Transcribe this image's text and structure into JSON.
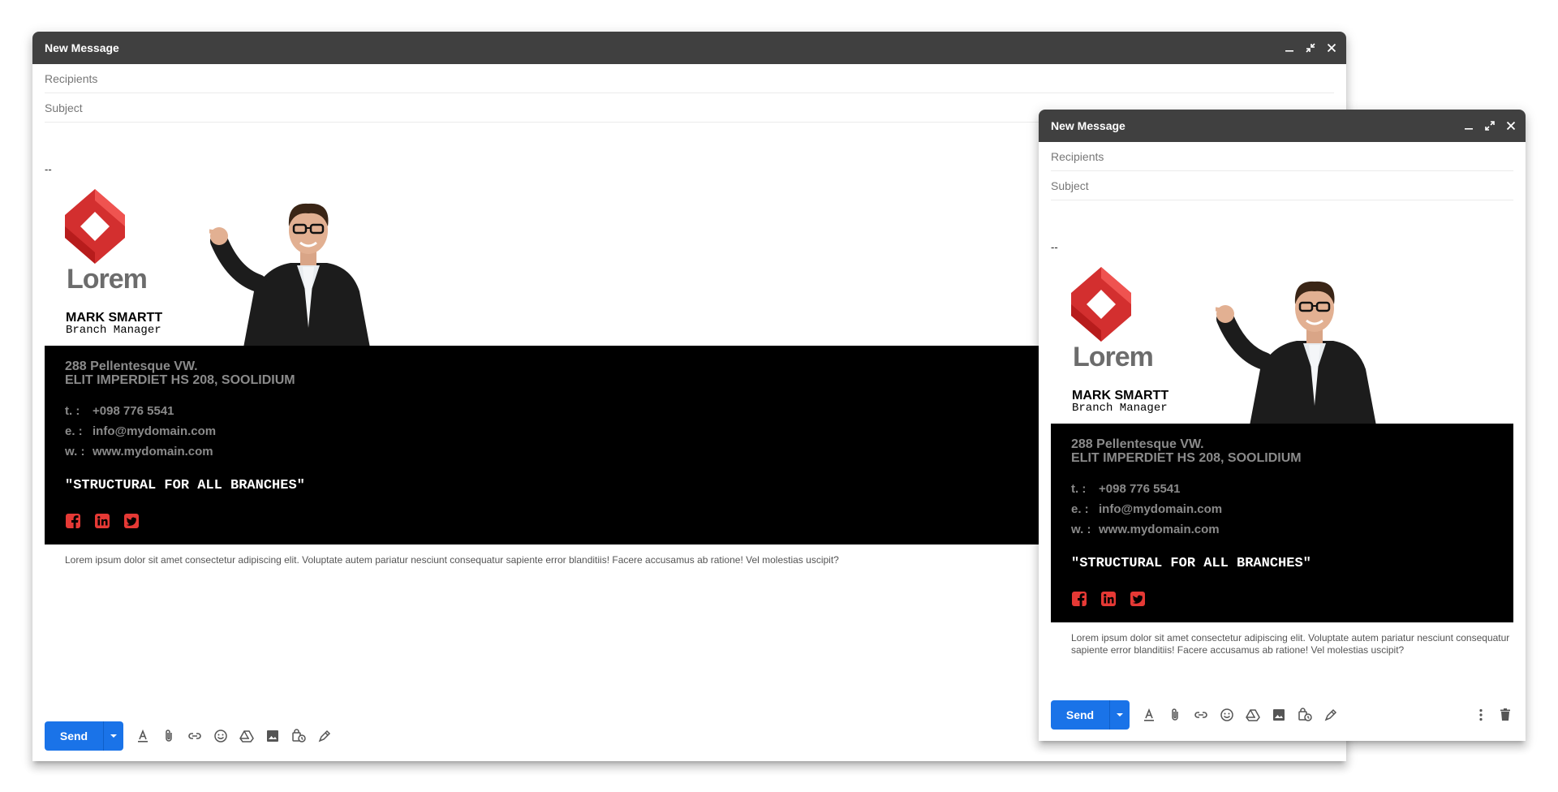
{
  "compose_large": {
    "title": "New Message",
    "recipients_placeholder": "Recipients",
    "subject_placeholder": "Subject",
    "signature_dash": "--",
    "send_label": "Send"
  },
  "compose_small": {
    "title": "New Message",
    "recipients_placeholder": "Recipients",
    "subject_placeholder": "Subject",
    "signature_dash": "--",
    "send_label": "Send"
  },
  "signature": {
    "logo_text": "Lorem",
    "name": "MARK SMARTT",
    "role": "Branch Manager",
    "address_line1": "288 Pellentesque VW.",
    "address_line2": "ELIT IMPERDIET HS 208, SOOLIDIUM",
    "phone_label": "t.  :",
    "phone": "+098 776 5541",
    "email_label": "e.  :",
    "email": "info@mydomain.com",
    "web_label": "w. :",
    "web": "www.mydomain.com",
    "slogan": "\"STRUCTURAL FOR ALL BRANCHES\"",
    "socials": [
      "facebook-icon",
      "linkedin-icon",
      "twitter-icon"
    ],
    "disclaimer": "Lorem ipsum dolor sit amet consectetur adipiscing elit. Voluptate autem pariatur nesciunt consequatur sapiente error blanditiis! Facere accusamus ab ratione! Vel molestias uscipit?"
  },
  "toolbar_icons": [
    "text-format-icon",
    "attach-icon",
    "link-icon",
    "emoji-icon",
    "drive-icon",
    "photo-icon",
    "confidential-icon",
    "signature-pen-icon"
  ],
  "colors": {
    "titlebar": "#404040",
    "send": "#1a73e8",
    "accent_red": "#e53935",
    "panel": "#000000"
  }
}
